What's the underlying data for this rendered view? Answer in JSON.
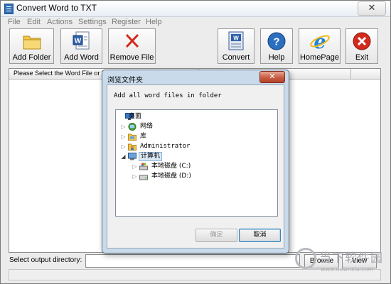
{
  "window": {
    "title": "Convert Word to TXT",
    "close_glyph": "✕"
  },
  "menu": [
    "File",
    "Edit",
    "Actions",
    "Settings",
    "Register",
    "Help"
  ],
  "toolbar": {
    "add_folder": "Add Folder",
    "add_word": "Add Word",
    "remove_file": "Remove File",
    "convert": "Convert",
    "help": "Help",
    "homepage": "HomePage",
    "exit": "Exit"
  },
  "file_list": {
    "header": "Please Select the Word File or Folder"
  },
  "output": {
    "label": "Select  output directory:",
    "value": "",
    "browse": "Browse",
    "view": "View"
  },
  "dialog": {
    "title": "浏览文件夹",
    "close_glyph": "✕",
    "description": "Add all word files in folder",
    "tree": [
      {
        "label": "桌面",
        "icon": "desktop-icon"
      },
      {
        "label": "网络",
        "icon": "network-icon"
      },
      {
        "label": "库",
        "icon": "library-icon"
      },
      {
        "label": "Administrator",
        "icon": "user-folder-icon"
      },
      {
        "label": "计算机",
        "icon": "computer-icon",
        "selected": true,
        "expanded": true
      },
      {
        "label": "本地磁盘 (C:)",
        "icon": "system-drive-icon"
      },
      {
        "label": "本地磁盘 (D:)",
        "icon": "drive-icon"
      }
    ],
    "ok": "确定",
    "ok_enabled": false,
    "cancel": "取消"
  },
  "watermark": {
    "text": "当下软件园",
    "sub": "www.downxia.com"
  },
  "colors": {
    "exit_red": "#d42a1e",
    "help_blue": "#2a6fc0",
    "ie_blue": "#1f86d6",
    "folder_yellow": "#f3c64a",
    "dialog_frame": "#c9daea"
  }
}
